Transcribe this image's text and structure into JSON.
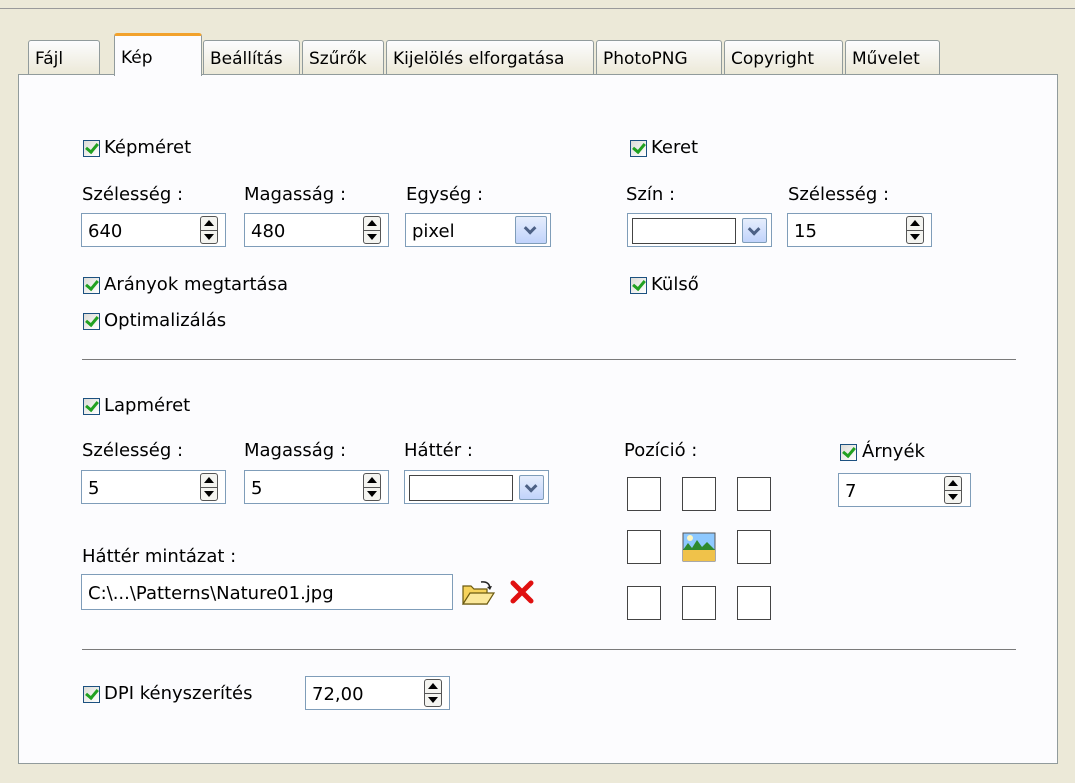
{
  "tabs": [
    "Fájl",
    "Kép",
    "Beállítás",
    "Szűrők",
    "Kijelölés elforgatása",
    "PhotoPNG",
    "Copyright",
    "Művelet"
  ],
  "image_size": {
    "checkbox_label": "Képméret",
    "width_label": "Szélesség :",
    "width_value": "640",
    "height_label": "Magasság :",
    "height_value": "480",
    "unit_label": "Egység :",
    "unit_value": "pixel",
    "keep_ratio_label": "Arányok megtartása",
    "optimize_label": "Optimalizálás"
  },
  "border": {
    "checkbox_label": "Keret",
    "color_label": "Szín :",
    "width_label": "Szélesség :",
    "width_value": "15",
    "outer_label": "Külső"
  },
  "page_size": {
    "checkbox_label": "Lapméret",
    "width_label": "Szélesség :",
    "width_value": "5",
    "height_label": "Magasság :",
    "height_value": "5",
    "background_label": "Háttér :",
    "pattern_label": "Háttér mintázat :",
    "pattern_value": "C:\\...\\Patterns\\Nature01.jpg",
    "position_label": "Pozíció :",
    "shadow_label": "Árnyék",
    "shadow_value": "7"
  },
  "dpi": {
    "checkbox_label": "DPI kényszerítés",
    "value": "72,00"
  },
  "icons": [
    "open-folder-icon",
    "delete-icon",
    "image-thumbnail-icon"
  ],
  "colors": {
    "check": "#21a121",
    "active_tab": "#f2a22c",
    "delete": "#e01010"
  }
}
